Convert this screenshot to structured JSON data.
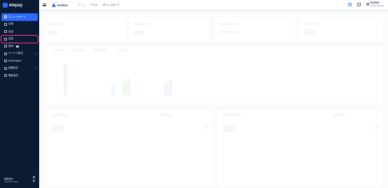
{
  "sidebar": {
    "brand": "elepay",
    "items": [
      {
        "label": "ダッシュボード",
        "icon": "dashboard-icon"
      },
      {
        "label": "決済",
        "icon": "payment-icon"
      },
      {
        "label": "返金",
        "icon": "refund-icon"
      },
      {
        "label": "送金",
        "icon": "transfer-icon"
      },
      {
        "label": "請求",
        "icon": "billing-icon",
        "badge": "β"
      },
      {
        "label": "サービス設定",
        "icon": "service-settings-icon"
      },
      {
        "label": "Marketplace",
        "icon": "marketplace-icon"
      },
      {
        "label": "組織設定",
        "icon": "org-settings-icon"
      },
      {
        "label": "開発者向",
        "icon": "developer-icon"
      }
    ],
    "footer_label": "開発者用"
  },
  "header": {
    "brand": "ELEPAY",
    "breadcrumb": [
      "ホーム",
      "ElePay",
      "ダッシュボード"
    ],
    "account_name": "ELEPAY",
    "account_sub": "ELEPAY株式会社"
  },
  "colors": {
    "accent": "#2d6bff",
    "sidebar_bg": "#0b1b33",
    "highlight": "#ff3b8a"
  }
}
